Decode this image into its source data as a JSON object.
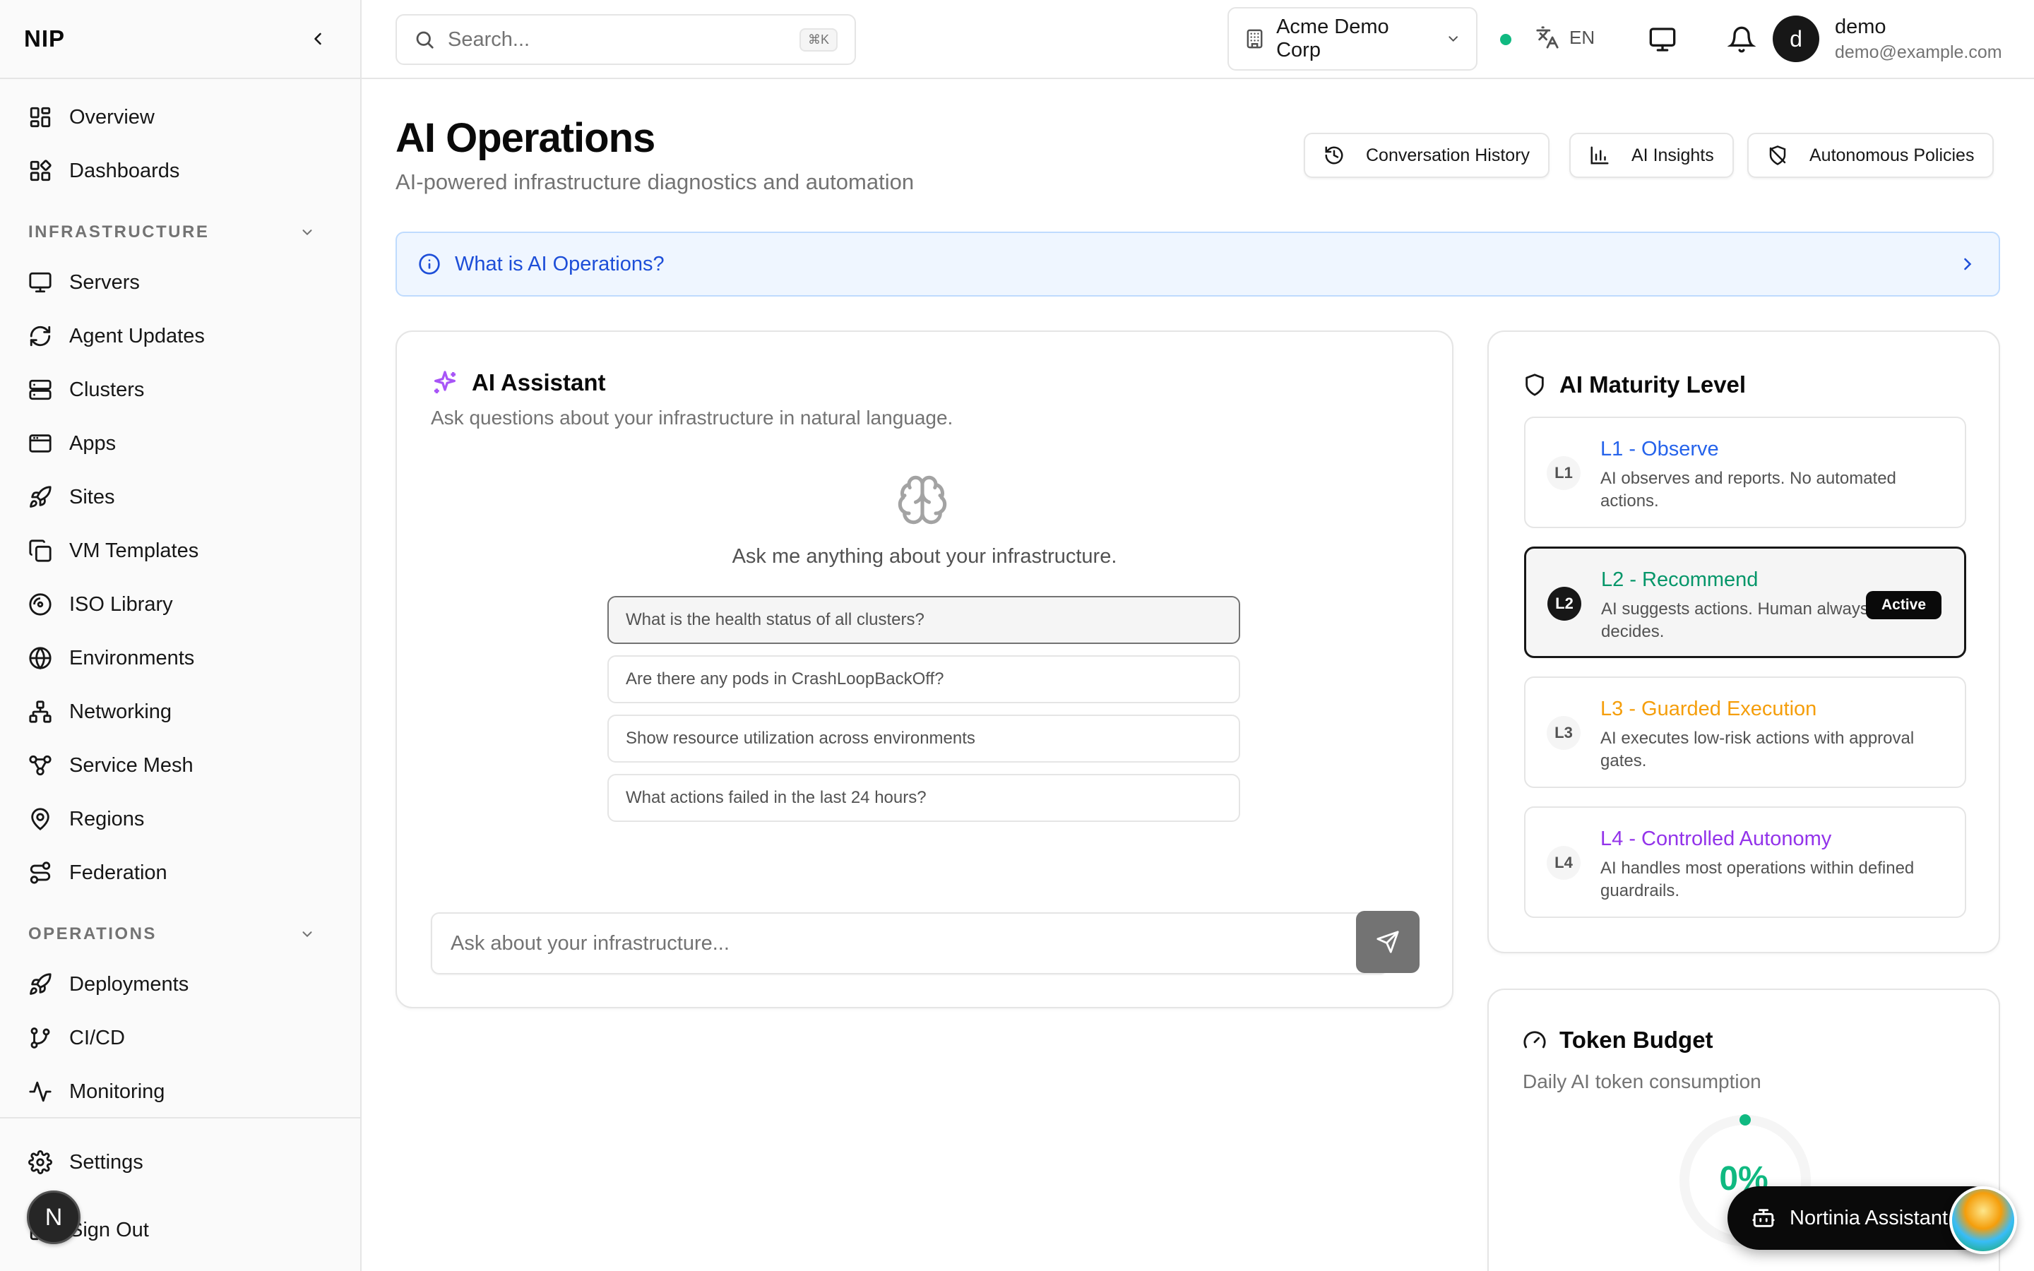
{
  "app": {
    "brand": "NIP"
  },
  "sidebar": {
    "top_items": [
      {
        "label": "Overview",
        "icon": "layout-dashboard-icon"
      },
      {
        "label": "Dashboards",
        "icon": "layout-grid-icon"
      }
    ],
    "sections": [
      {
        "label": "INFRASTRUCTURE",
        "items": [
          {
            "label": "Servers",
            "icon": "monitor-icon"
          },
          {
            "label": "Agent Updates",
            "icon": "refresh-icon"
          },
          {
            "label": "Clusters",
            "icon": "server-icon"
          },
          {
            "label": "Apps",
            "icon": "app-window-icon"
          },
          {
            "label": "Sites",
            "icon": "rocket-icon"
          },
          {
            "label": "VM Templates",
            "icon": "copy-icon"
          },
          {
            "label": "ISO Library",
            "icon": "disc-icon"
          },
          {
            "label": "Environments",
            "icon": "globe-icon"
          },
          {
            "label": "Networking",
            "icon": "network-icon"
          },
          {
            "label": "Service Mesh",
            "icon": "workflow-icon"
          },
          {
            "label": "Regions",
            "icon": "map-pin-icon"
          },
          {
            "label": "Federation",
            "icon": "route-icon"
          }
        ]
      },
      {
        "label": "OPERATIONS",
        "items": [
          {
            "label": "Deployments",
            "icon": "rocket-icon"
          },
          {
            "label": "CI/CD",
            "icon": "git-branch-icon"
          },
          {
            "label": "Monitoring",
            "icon": "activity-icon"
          }
        ]
      }
    ],
    "footer": {
      "settings": "Settings",
      "signout": "Sign Out",
      "avatar_letter": "N"
    }
  },
  "topbar": {
    "search_placeholder": "Search...",
    "search_shortcut": "⌘K",
    "org": "Acme Demo Corp",
    "lang": "EN",
    "user": {
      "initial": "d",
      "name": "demo",
      "email": "demo@example.com"
    }
  },
  "page": {
    "title": "AI Operations",
    "subtitle": "AI-powered infrastructure diagnostics and automation",
    "buttons": {
      "history": "Conversation History",
      "insights": "AI Insights",
      "policies": "Autonomous Policies"
    },
    "banner": "What is AI Operations?"
  },
  "assistant": {
    "title": "AI Assistant",
    "description": "Ask questions about your infrastructure in natural language.",
    "empty": "Ask me anything about your infrastructure.",
    "suggestions": [
      "What is the health status of all clusters?",
      "Are there any pods in CrashLoopBackOff?",
      "Show resource utilization across environments",
      "What actions failed in the last 24 hours?"
    ],
    "input_placeholder": "Ask about your infrastructure..."
  },
  "maturity": {
    "title": "AI Maturity Level",
    "active_label": "Active",
    "levels": [
      {
        "code": "L1",
        "name": "L1 - Observe",
        "desc": "AI observes and reports. No automated actions.",
        "color": "#2563eb"
      },
      {
        "code": "L2",
        "name": "L2 - Recommend",
        "desc": "AI suggests actions. Human always decides.",
        "color": "#059669"
      },
      {
        "code": "L3",
        "name": "L3 - Guarded Execution",
        "desc": "AI executes low-risk actions with approval gates.",
        "color": "#f59e0b"
      },
      {
        "code": "L4",
        "name": "L4 - Controlled Autonomy",
        "desc": "AI handles most operations within defined guardrails.",
        "color": "#9333ea"
      }
    ]
  },
  "token_budget": {
    "title": "Token Budget",
    "description": "Daily AI token consumption",
    "percent": "0%",
    "percent_value": 0
  },
  "floating": {
    "label": "Nortinia Assistant"
  },
  "colors": {
    "accent_green": "#10b981",
    "info_blue": "#1d4ed8",
    "ai_purple": "#a855f7"
  }
}
